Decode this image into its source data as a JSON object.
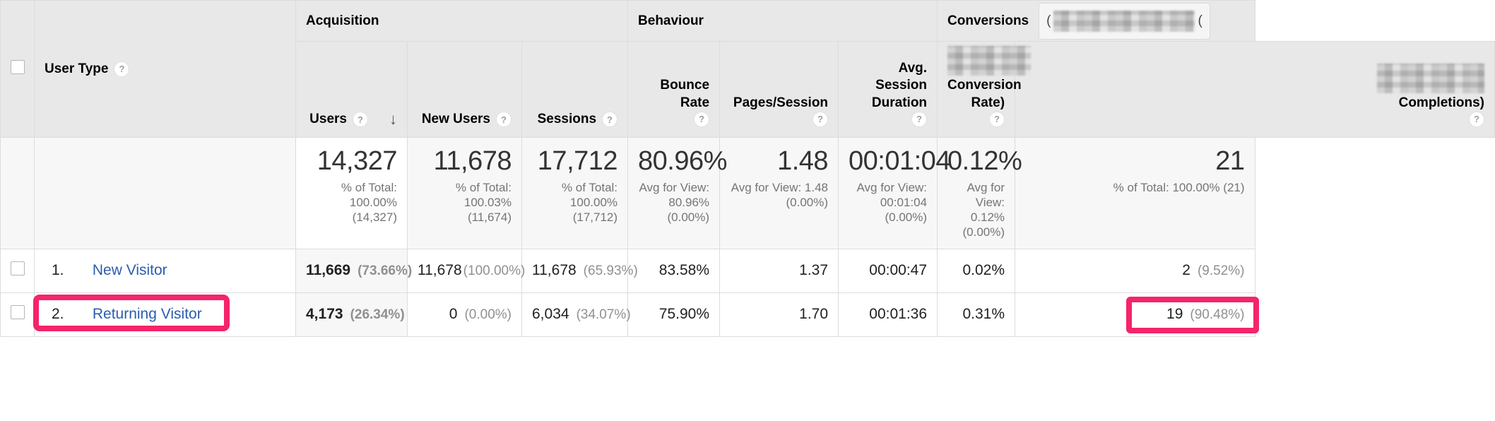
{
  "table": {
    "dimension_header": {
      "label": "User Type",
      "help_icon": "help-icon"
    },
    "groups": [
      {
        "key": "acquisition",
        "label": "Acquisition"
      },
      {
        "key": "behaviour",
        "label": "Behaviour"
      },
      {
        "key": "conversions",
        "label": "Conversions",
        "selector_value": "",
        "selector_redacted": true
      }
    ],
    "columns": [
      {
        "key": "users",
        "label": "Users",
        "help_icon": "help-icon",
        "sorted": true,
        "sort_direction": "descending",
        "sort_icon": "arrow-down-icon"
      },
      {
        "key": "new_users",
        "label": "New Users",
        "help_icon": "help-icon",
        "sorted": false
      },
      {
        "key": "sessions",
        "label": "Sessions",
        "help_icon": "help-icon",
        "sorted": false
      },
      {
        "key": "bounce_rate",
        "label": "Bounce Rate",
        "help_icon": "help-icon",
        "sorted": false
      },
      {
        "key": "pages_session",
        "label": "Pages/Session",
        "help_icon": "help-icon",
        "sorted": false
      },
      {
        "key": "avg_duration",
        "label": "Avg. Session Duration",
        "help_icon": "help-icon",
        "sorted": false
      },
      {
        "key": "conv_rate",
        "label": "Conversion Rate)",
        "help_icon": "help-icon",
        "redacted_prefix": true,
        "sorted": false
      },
      {
        "key": "completions",
        "label": "Completions)",
        "help_icon": "help-icon",
        "redacted_prefix": true,
        "sorted": false
      }
    ],
    "summary_row": {
      "users": {
        "value": "14,327",
        "sub": "% of Total: 100.00% (14,327)"
      },
      "new_users": {
        "value": "11,678",
        "sub": "% of Total: 100.03% (11,674)"
      },
      "sessions": {
        "value": "17,712",
        "sub": "% of Total: 100.00% (17,712)"
      },
      "bounce_rate": {
        "value": "80.96%",
        "sub": "Avg for View: 80.96% (0.00%)"
      },
      "pages_session": {
        "value": "1.48",
        "sub": "Avg for View: 1.48 (0.00%)"
      },
      "avg_duration": {
        "value": "00:01:04",
        "sub": "Avg for View: 00:01:04 (0.00%)"
      },
      "conv_rate": {
        "value": "0.12%",
        "sub": "Avg for View: 0.12% (0.00%)"
      },
      "completions": {
        "value": "21",
        "sub": "% of Total: 100.00% (21)"
      }
    },
    "rows": [
      {
        "index": "1.",
        "name": "New Visitor",
        "checkbox_checked": false,
        "highlighted_name": false,
        "highlighted_completions": false,
        "users": "11,669",
        "users_pct": "(73.66%)",
        "new_users": "11,678",
        "new_users_pct": "(100.00%)",
        "sessions": "11,678",
        "sessions_pct": "(65.93%)",
        "bounce_rate": "83.58%",
        "pages_session": "1.37",
        "avg_duration": "00:00:47",
        "conv_rate": "0.02%",
        "completions": "2",
        "completions_pct": "(9.52%)"
      },
      {
        "index": "2.",
        "name": "Returning Visitor",
        "checkbox_checked": false,
        "highlighted_name": true,
        "highlighted_completions": true,
        "users": "4,173",
        "users_pct": "(26.34%)",
        "new_users": "0",
        "new_users_pct": "(0.00%)",
        "sessions": "6,034",
        "sessions_pct": "(34.07%)",
        "bounce_rate": "75.90%",
        "pages_session": "1.70",
        "avg_duration": "00:01:36",
        "conv_rate": "0.31%",
        "completions": "19",
        "completions_pct": "(90.48%)"
      }
    ]
  },
  "annotation": {
    "color": "#f5246b",
    "targets": [
      "returning-visitor-name",
      "returning-visitor-completions"
    ]
  },
  "icons": {
    "help": "?",
    "sort_down": "↓"
  }
}
